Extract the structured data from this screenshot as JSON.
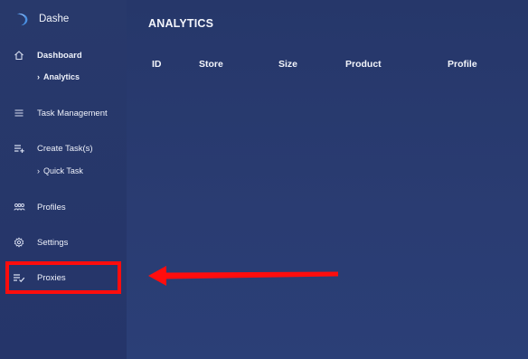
{
  "brand": {
    "name": "Dashe",
    "logo_icon": "crescent-logo-icon"
  },
  "sidebar": {
    "items": [
      {
        "label": "Dashboard",
        "icon": "home-icon"
      },
      {
        "label": "Analytics",
        "icon": "chevron-right-icon",
        "sub": true,
        "active": true
      },
      {
        "label": "Task Management",
        "icon": "list-icon"
      },
      {
        "label": "Create Task(s)",
        "icon": "playlist-add-icon"
      },
      {
        "label": "Quick Task",
        "icon": "chevron-right-icon",
        "sub": true
      },
      {
        "label": "Profiles",
        "icon": "people-icon"
      },
      {
        "label": "Settings",
        "icon": "gear-icon"
      },
      {
        "label": "Proxies",
        "icon": "playlist-check-icon"
      }
    ]
  },
  "main": {
    "title": "ANALYTICS",
    "table": {
      "columns": [
        "ID",
        "Store",
        "Size",
        "Product",
        "Profile"
      ],
      "rows": []
    }
  },
  "annotation": {
    "highlight_color": "#ff0d0d",
    "target": "Proxies"
  },
  "colors": {
    "sidebar_bg": "#27386a",
    "main_bg": "#2a3c72",
    "text": "#f3f5fb"
  }
}
